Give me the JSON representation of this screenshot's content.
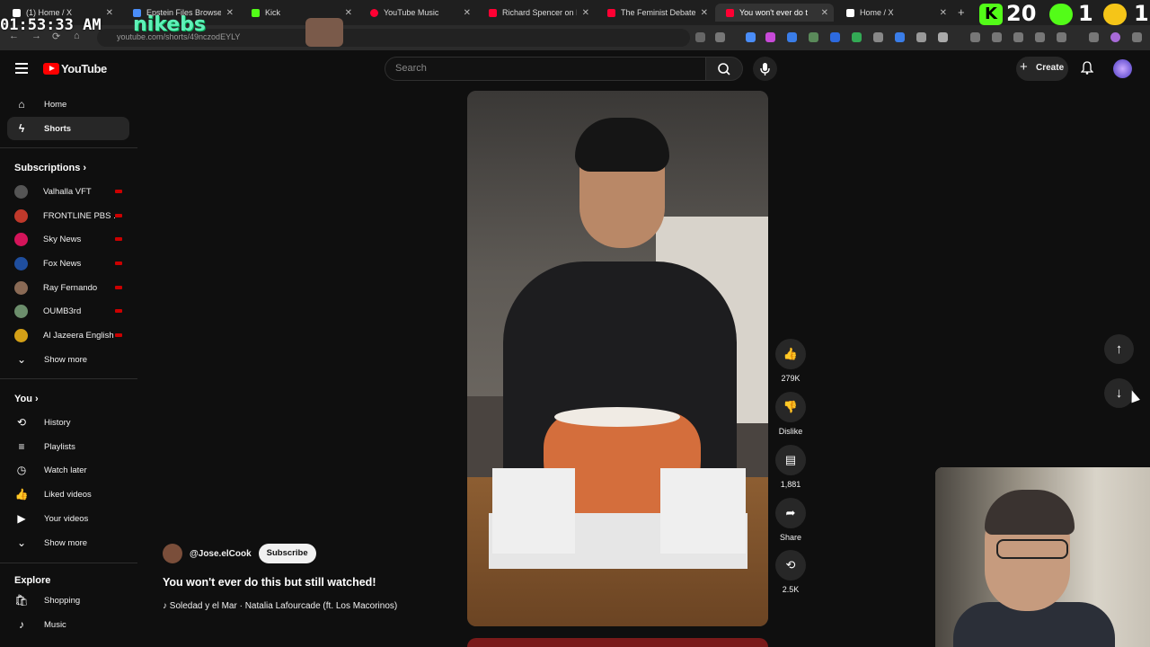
{
  "browser": {
    "tabs": [
      {
        "title": "(1) Home / X",
        "color": "#ffffff"
      },
      {
        "title": "Epstein Files Browser",
        "color": "#4a8df8"
      },
      {
        "title": "Kick",
        "color": "#53fc18"
      },
      {
        "title": "YouTube Music",
        "color": "#ff0033"
      },
      {
        "title": "Richard Spencer on Isra",
        "color": "#ff0033"
      },
      {
        "title": "The Feminist Debate - Y",
        "color": "#ff0033"
      },
      {
        "title": "You won't ever do t",
        "color": "#ff0033",
        "active": true
      },
      {
        "title": "Home / X",
        "color": "#ffffff"
      }
    ],
    "url": "youtube.com/shorts/49nczodEYLY"
  },
  "overlay": {
    "clock": "01:53:33 AM",
    "stream_text": "nikebs",
    "kick_letter": "K",
    "kick_count": "20",
    "kick_count2": "1",
    "kick_count3": "1"
  },
  "header": {
    "logo_text": "YouTube",
    "search_placeholder": "Search",
    "create_label": "Create"
  },
  "sidebar": {
    "primary": [
      {
        "label": "Home",
        "icon": "home-icon",
        "glyph": "⌂"
      },
      {
        "label": "Shorts",
        "icon": "shorts-icon",
        "glyph": "ϟ",
        "active": true
      }
    ],
    "subscriptions_heading": "Subscriptions",
    "subscriptions": [
      {
        "label": "Valhalla VFT",
        "color": "#555555"
      },
      {
        "label": "FRONTLINE PBS ...",
        "color": "#c0392b"
      },
      {
        "label": "Sky News",
        "color": "#d4145a"
      },
      {
        "label": "Fox News",
        "color": "#1f4e9e"
      },
      {
        "label": "Ray Fernando",
        "color": "#8a6a55"
      },
      {
        "label": "OUMB3rd",
        "color": "#6c8e6c"
      },
      {
        "label": "Al Jazeera English",
        "color": "#d4a017"
      }
    ],
    "show_more": "Show more",
    "you_heading": "You",
    "you_items": [
      {
        "label": "History",
        "icon": "history-icon",
        "glyph": "⟲"
      },
      {
        "label": "Playlists",
        "icon": "playlists-icon",
        "glyph": "≡"
      },
      {
        "label": "Watch later",
        "icon": "clock-icon",
        "glyph": "◷"
      },
      {
        "label": "Liked videos",
        "icon": "thumb-up-icon",
        "glyph": "👍"
      },
      {
        "label": "Your videos",
        "icon": "your-videos-icon",
        "glyph": "▶"
      }
    ],
    "show_more_2": "Show more",
    "explore_heading": "Explore",
    "explore_items": [
      {
        "label": "Shopping",
        "icon": "shopping-icon",
        "glyph": "🛍"
      },
      {
        "label": "Music",
        "icon": "music-icon",
        "glyph": "♪"
      }
    ]
  },
  "short": {
    "channel": "@Jose.elCook",
    "subscribe_label": "Subscribe",
    "title": "You won't ever do this but still watched!",
    "music": "♪ Soledad y el Mar · Natalia Lafourcade (ft. Los Macorinos)"
  },
  "actions": {
    "likes": "279K",
    "dislike": "Dislike",
    "comments": "1,881",
    "share": "Share",
    "remix": "2.5K"
  }
}
